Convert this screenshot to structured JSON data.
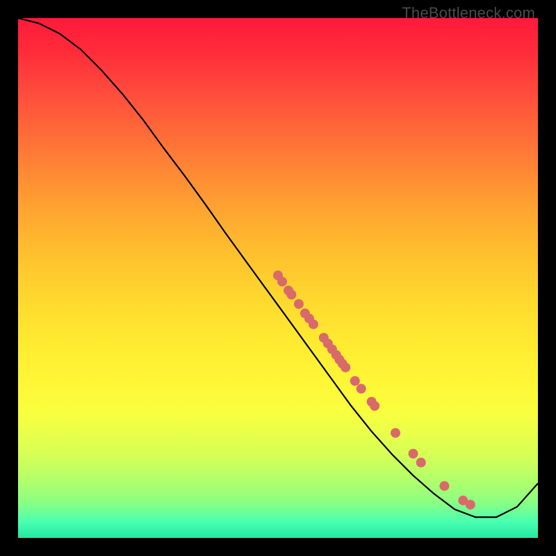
{
  "watermark": "TheBottleneck.com",
  "colors": {
    "curve": "#000000",
    "dot_fill": "#d96a6a",
    "dot_stroke": "#b94e4e"
  },
  "chart_data": {
    "type": "line",
    "title": "",
    "xlabel": "",
    "ylabel": "",
    "xlim": [
      0,
      100
    ],
    "ylim": [
      0,
      100
    ],
    "grid": false,
    "legend": false,
    "series": [
      {
        "name": "bottleneck_curve",
        "x": [
          0,
          4,
          8,
          12,
          16,
          20,
          24,
          28,
          32,
          36,
          40,
          44,
          48,
          52,
          56,
          60,
          64,
          68,
          72,
          76,
          80,
          84,
          88,
          92,
          96,
          100
        ],
        "y": [
          100,
          99,
          97,
          94,
          90,
          85.5,
          80.5,
          75,
          69.7,
          64.2,
          58.5,
          53,
          47.5,
          42,
          36.5,
          31,
          25.5,
          20.5,
          16,
          12,
          8.5,
          5.5,
          4,
          4,
          6,
          10.5
        ]
      }
    ],
    "points": [
      {
        "x": 50.0,
        "y": 50.5
      },
      {
        "x": 50.8,
        "y": 49.3
      },
      {
        "x": 52.0,
        "y": 47.6
      },
      {
        "x": 52.6,
        "y": 46.8
      },
      {
        "x": 54.0,
        "y": 45.0
      },
      {
        "x": 55.2,
        "y": 43.2
      },
      {
        "x": 56.0,
        "y": 42.2
      },
      {
        "x": 56.8,
        "y": 41.1
      },
      {
        "x": 58.8,
        "y": 38.5
      },
      {
        "x": 59.6,
        "y": 37.4
      },
      {
        "x": 60.4,
        "y": 36.3
      },
      {
        "x": 61.2,
        "y": 35.2
      },
      {
        "x": 61.8,
        "y": 34.3
      },
      {
        "x": 62.4,
        "y": 33.5
      },
      {
        "x": 63.0,
        "y": 32.8
      },
      {
        "x": 64.8,
        "y": 30.2
      },
      {
        "x": 66.0,
        "y": 28.7
      },
      {
        "x": 68.0,
        "y": 26.2
      },
      {
        "x": 68.6,
        "y": 25.4
      },
      {
        "x": 72.6,
        "y": 20.2
      },
      {
        "x": 76.0,
        "y": 16.2
      },
      {
        "x": 77.5,
        "y": 14.5
      },
      {
        "x": 82.0,
        "y": 10.0
      },
      {
        "x": 85.6,
        "y": 7.2
      },
      {
        "x": 87.0,
        "y": 6.4
      }
    ]
  }
}
